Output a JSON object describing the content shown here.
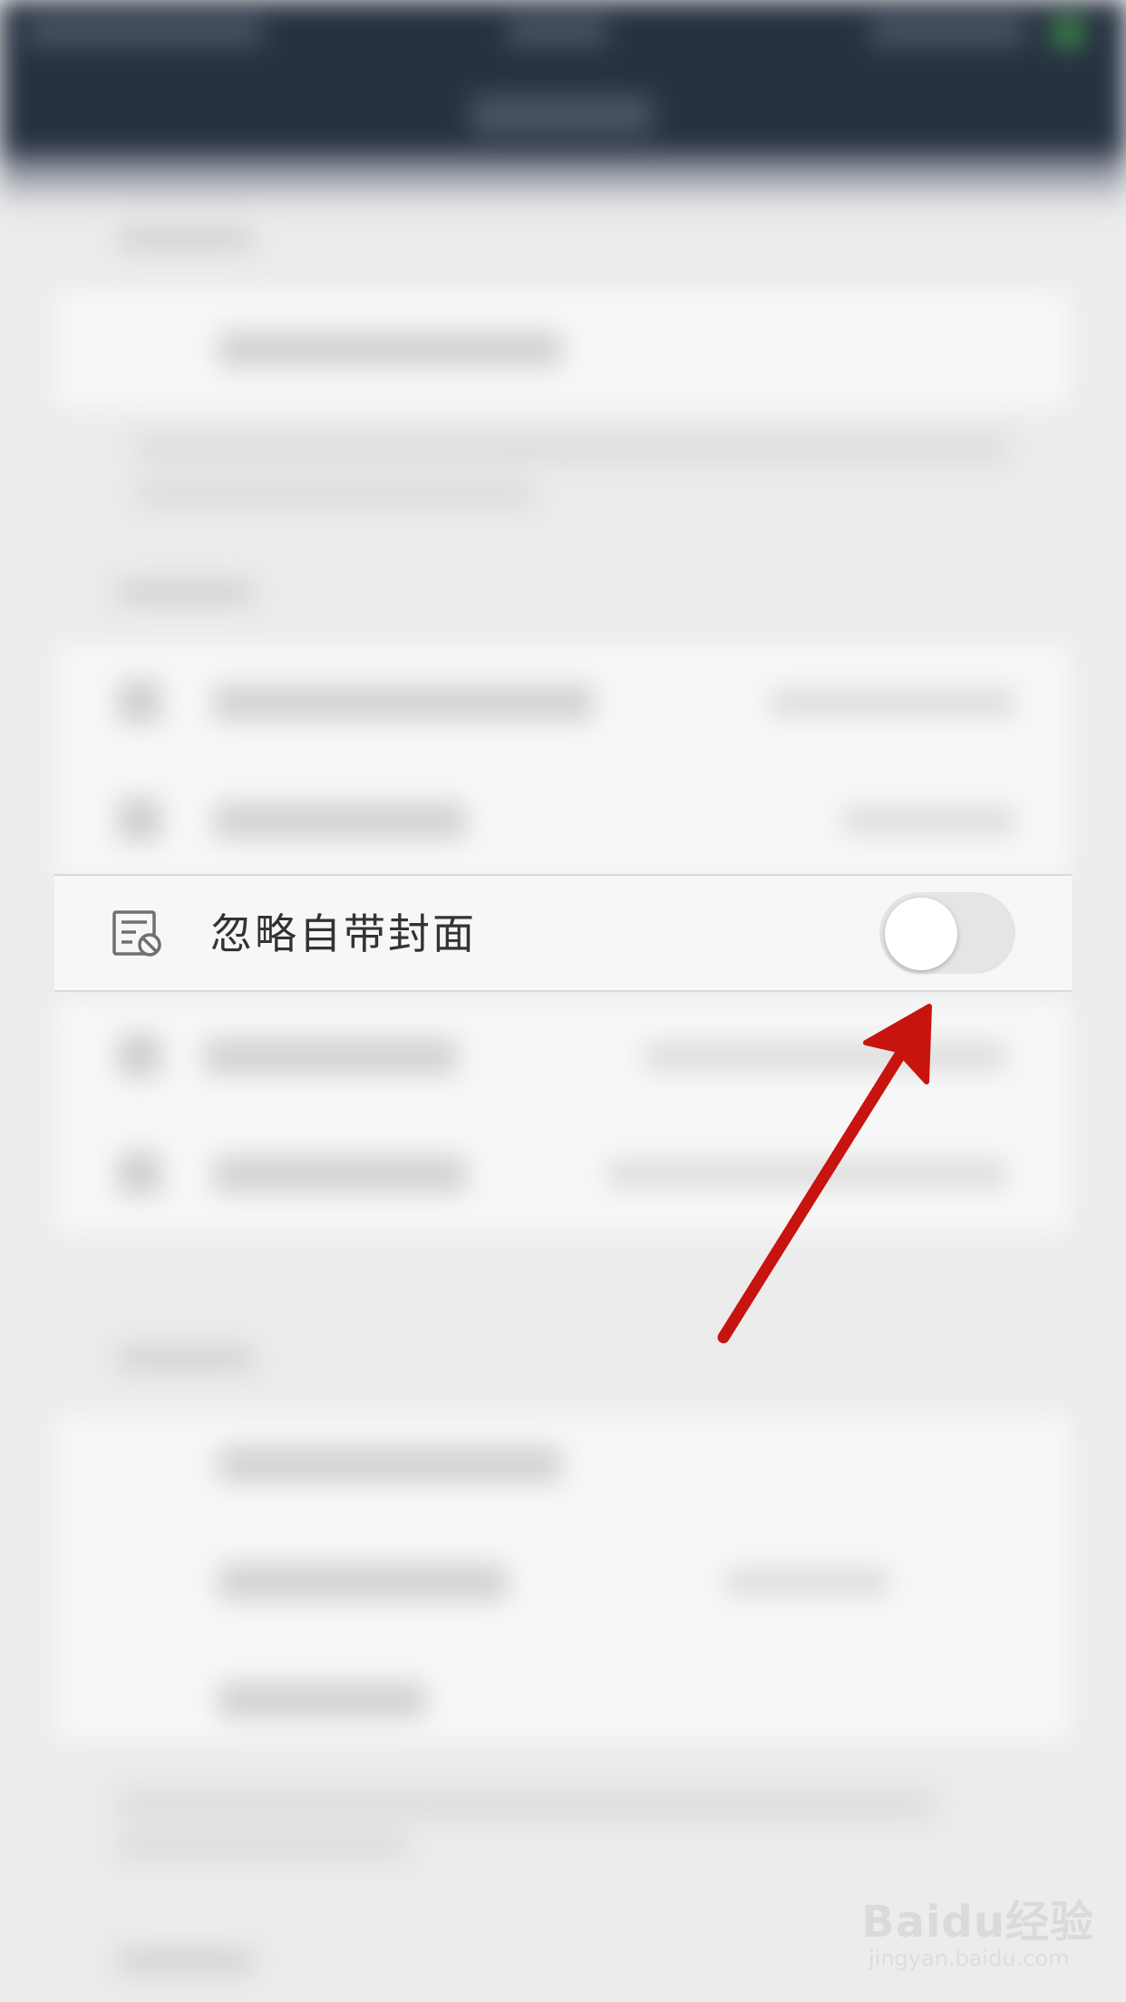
{
  "setting_row": {
    "label": "忽略自带封面",
    "icon": "cover-ignore-icon",
    "toggle_state": "off"
  },
  "annotation": {
    "arrow_color": "#c8140e",
    "points_to": "toggle"
  },
  "watermark": {
    "brand": "Baidu经验",
    "url": "jingyan.baidu.com"
  },
  "colors": {
    "header_bg": "#273241",
    "page_bg": "#ececec",
    "row_bg": "#f7f7f7",
    "toggle_track": "#e5e5e7",
    "toggle_knob": "#ffffff"
  }
}
